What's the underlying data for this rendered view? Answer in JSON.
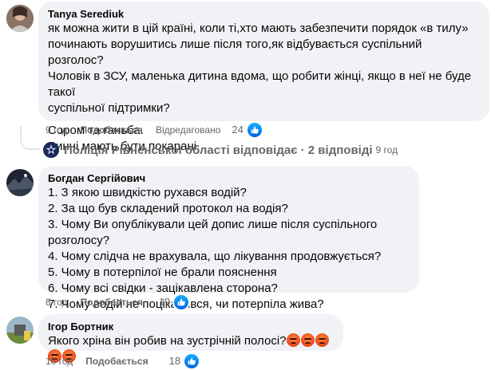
{
  "comments": [
    {
      "author": "Tanya Serediuk",
      "paragraphs": [
        [
          "як можна жити в цій країні, коли ті,хто мають забезпечити порядок «в тилу»",
          "починають ворушитись лише після того,як відбувається суспільний розголос?",
          "Чоловік в ЗСУ, маленька дитина вдома, що робити жінці, якщо в неї не буде такої",
          "суспільної підтримки?"
        ],
        [
          "Сором та ганьба.",
          "Винні мають бути покарані."
        ]
      ],
      "time": "9 год",
      "like_label": "Подобається",
      "edited_label": "Відредаговано",
      "reactions": "24"
    },
    {
      "author": "Богдан Сергійович",
      "lines": [
        "1. З якою швидкістю рухався водій?",
        "2. За що був складений протокол на водія?",
        "3. Чому Ви опублікували цей допис лише після суспільного розголосу?",
        "4. Чому слідча не врахувала, що лікування продовжується?",
        "5. Чому в потерпілої не брали пояснення",
        "6. Чому всі свідки - зацікавлена сторона?",
        "7. Чому водій не поцікавився, чи потерпіла жива?"
      ],
      "time": "8 год",
      "like_label": "Подобається",
      "reactions": "19"
    },
    {
      "author": "Ігор Бортник",
      "text": "Якого хріна він робив на зустрічній полосі?",
      "emoji_count": 5,
      "time": "10 год",
      "like_label": "Подобається",
      "reactions": "18"
    }
  ],
  "replies_link": {
    "label": "Поліція Рівненської області відповідає · 2 відповіді",
    "time": "9 год"
  },
  "colors": {
    "bubble": "#f0f2f5",
    "meta_text": "#65676b",
    "like_blue": "#0866ff",
    "angry_emoji": "#e8451c"
  }
}
